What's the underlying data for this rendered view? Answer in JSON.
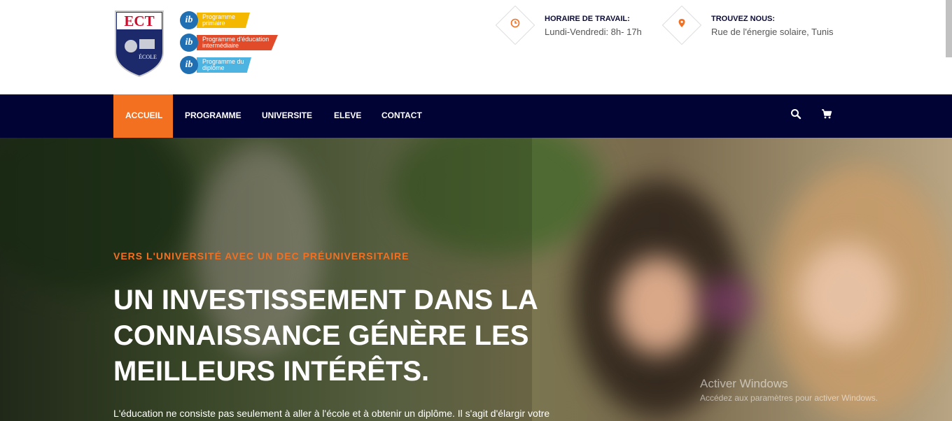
{
  "header": {
    "logo_text": "ECT",
    "logo_subtext": "ÉCOLE",
    "ib_programmes": [
      {
        "label": "Programme primaire"
      },
      {
        "label": "Programme d'éducation intermédiaire"
      },
      {
        "label": "Programme du diplôme"
      }
    ],
    "hours": {
      "label": "HORAIRE DE TRAVAIL:",
      "value": "Lundi-Vendredi: 8h- 17h",
      "icon": "clock-icon"
    },
    "location": {
      "label": "TROUVEZ NOUS:",
      "value": "Rue de l'énergie solaire, Tunis",
      "icon": "map-pin-icon"
    }
  },
  "nav": {
    "items": [
      {
        "label": "ACCUEIL",
        "active": true
      },
      {
        "label": "PROGRAMME",
        "active": false
      },
      {
        "label": "UNIVERSITE",
        "active": false
      },
      {
        "label": "ELEVE",
        "active": false
      },
      {
        "label": "CONTACT",
        "active": false
      }
    ],
    "icons": [
      "search-icon",
      "cart-icon"
    ]
  },
  "hero": {
    "subtitle": "VERS L'UNIVERSITÉ AVEC UN DEC PRÉUNIVERSITAIRE",
    "title": "UN INVESTISSEMENT DANS LA CONNAISSANCE GÉNÈRE LES MEILLEURS INTÉRÊTS.",
    "text": "L'éducation ne consiste pas seulement à aller à l'école et à obtenir un diplôme. Il s'agit d'élargir votre"
  },
  "watermark": {
    "line1": "Activer Windows",
    "line2": "Accédez aux paramètres pour activer Windows."
  },
  "colors": {
    "accent": "#f37021",
    "nav_bg": "#020335",
    "heading": "#0b0b3a"
  }
}
